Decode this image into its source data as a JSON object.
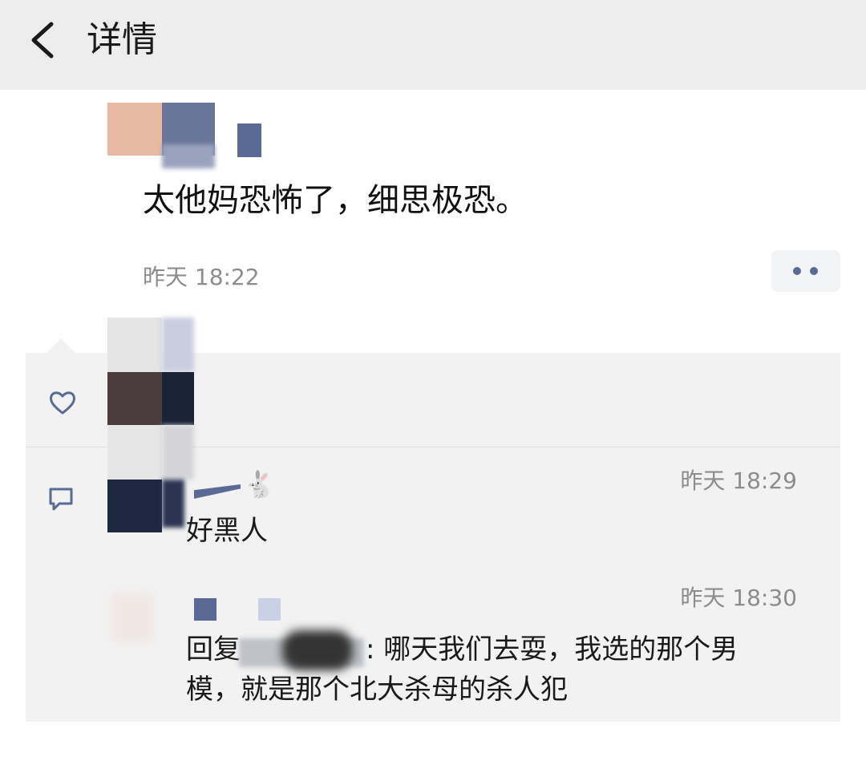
{
  "header": {
    "title": "详情",
    "back_icon": "chevron-left-icon"
  },
  "post": {
    "text": "太他妈恐怖了，细思极恐。",
    "time": "昨天 18:22",
    "more_icon": "more-dots-icon",
    "accent_color": "#576b95"
  },
  "interactions": {
    "like_icon": "heart-icon",
    "comment_icon": "comment-icon",
    "comments": [
      {
        "author_emoji": "🐇",
        "time": "昨天 18:29",
        "text": "好黑人"
      },
      {
        "time": "昨天 18:30",
        "prefix": "回复",
        "text_line1": ": 哪天我们去耍，我选的那个男",
        "text_line2": "模，就是那个北大杀母的杀人犯"
      }
    ]
  }
}
